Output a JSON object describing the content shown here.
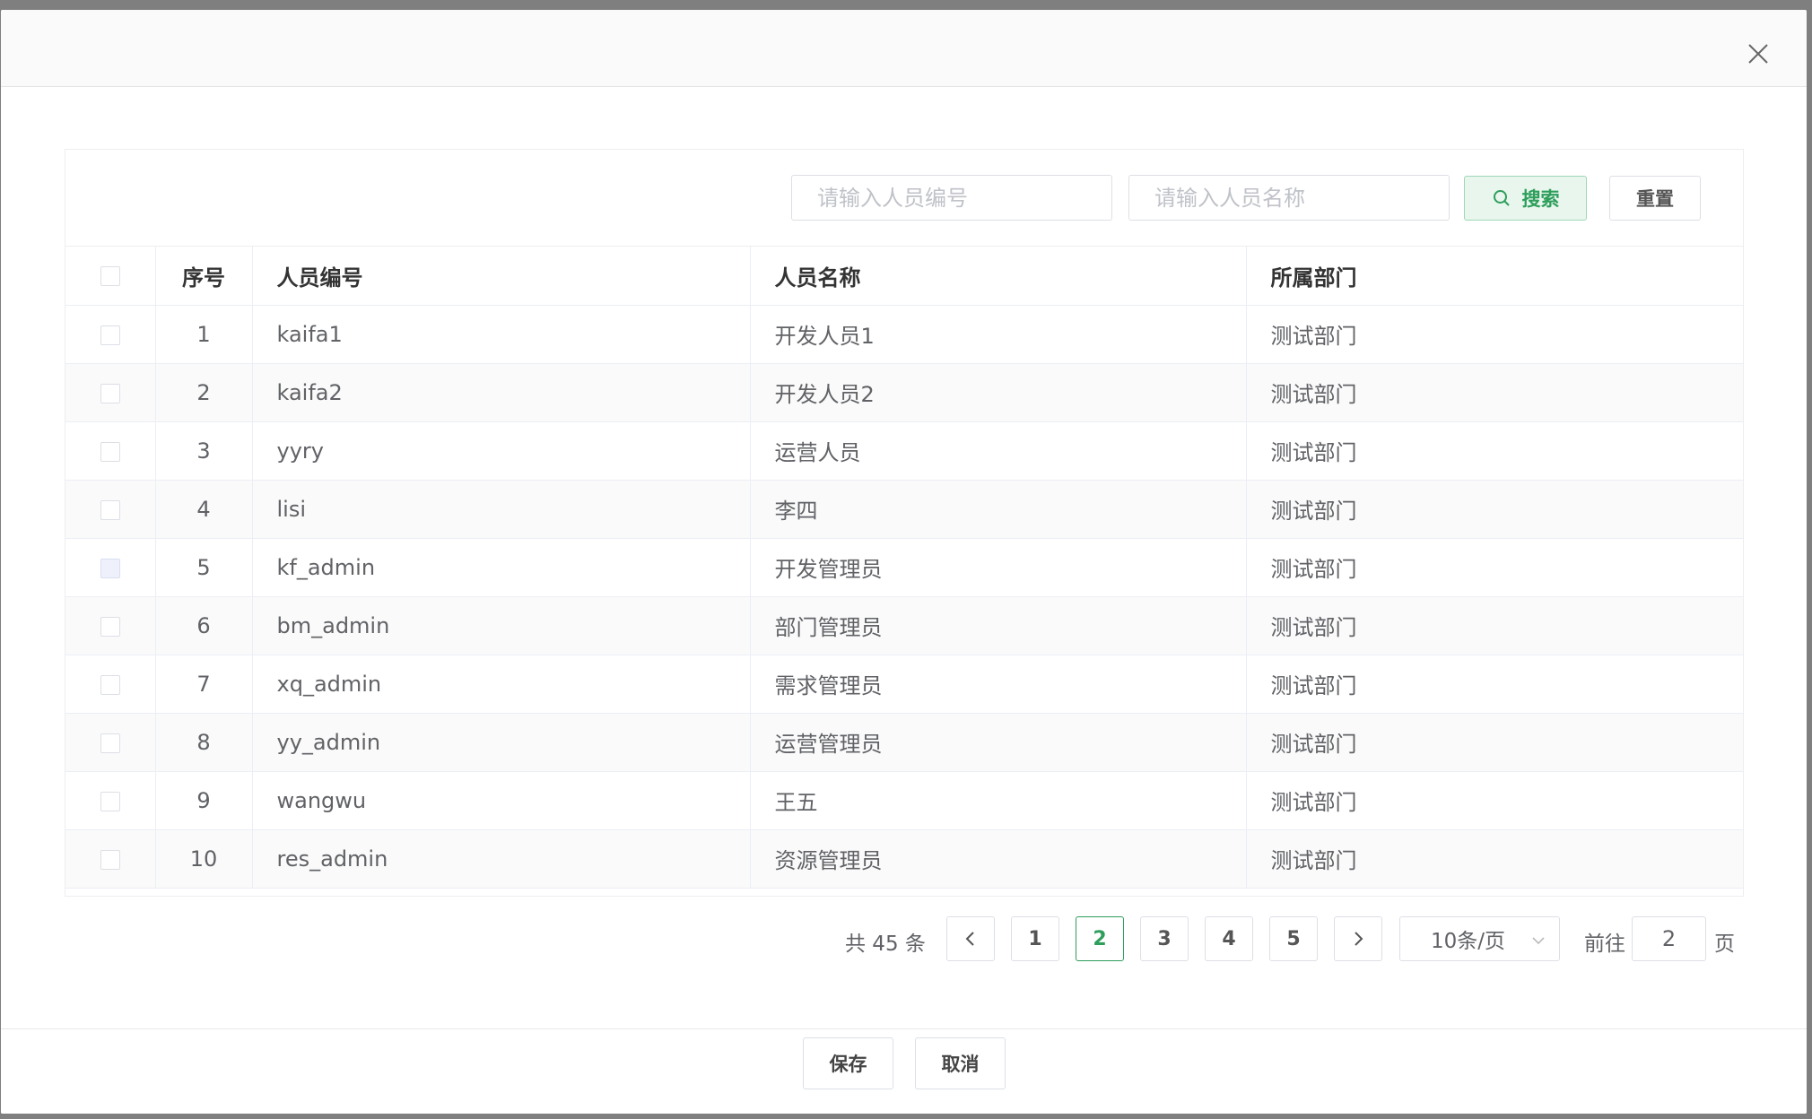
{
  "header": {
    "close_icon": "close-icon"
  },
  "search": {
    "code_placeholder": "请输入人员编号",
    "name_placeholder": "请输入人员名称",
    "search_label": "搜索",
    "search_icon": "search-icon",
    "reset_label": "重置"
  },
  "table": {
    "columns": [
      "序号",
      "人员编号",
      "人员名称",
      "所属部门"
    ],
    "rows": [
      {
        "index": "1",
        "code": "kaifa1",
        "name": "开发人员1",
        "dept": "测试部门"
      },
      {
        "index": "2",
        "code": "kaifa2",
        "name": "开发人员2",
        "dept": "测试部门"
      },
      {
        "index": "3",
        "code": "yyry",
        "name": "运营人员",
        "dept": "测试部门"
      },
      {
        "index": "4",
        "code": "lisi",
        "name": "李四",
        "dept": "测试部门"
      },
      {
        "index": "5",
        "code": "kf_admin",
        "name": "开发管理员",
        "dept": "测试部门"
      },
      {
        "index": "6",
        "code": "bm_admin",
        "name": "部门管理员",
        "dept": "测试部门"
      },
      {
        "index": "7",
        "code": "xq_admin",
        "name": "需求管理员",
        "dept": "测试部门"
      },
      {
        "index": "8",
        "code": "yy_admin",
        "name": "运营管理员",
        "dept": "测试部门"
      },
      {
        "index": "9",
        "code": "wangwu",
        "name": "王五",
        "dept": "测试部门"
      },
      {
        "index": "10",
        "code": "res_admin",
        "name": "资源管理员",
        "dept": "测试部门"
      }
    ]
  },
  "pagination": {
    "total_text": "共 45 条",
    "pages": [
      "1",
      "2",
      "3",
      "4",
      "5"
    ],
    "current_page": "2",
    "page_size": "10条/页",
    "goto_label": "前往",
    "goto_value": "2",
    "goto_suffix": "页"
  },
  "footer": {
    "save_label": "保存",
    "cancel_label": "取消"
  },
  "colors": {
    "accent": "#2e9e5b",
    "accent_bg": "#e8f6ee",
    "border": "#dcdfe6"
  }
}
